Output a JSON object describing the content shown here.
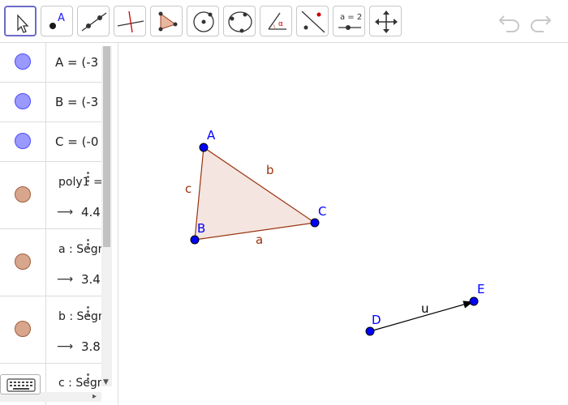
{
  "toolbar": {
    "tools": [
      {
        "icon": "move-arrow-icon",
        "selected": true
      },
      {
        "icon": "point-icon",
        "label": "A"
      },
      {
        "icon": "line-icon"
      },
      {
        "icon": "perpendicular-line-icon"
      },
      {
        "icon": "polygon-icon"
      },
      {
        "icon": "circle-center-point-icon"
      },
      {
        "icon": "circle-three-points-icon"
      },
      {
        "icon": "angle-icon",
        "label": "α"
      },
      {
        "icon": "reflect-about-line-icon"
      },
      {
        "icon": "slider-icon",
        "label": "a = 2"
      },
      {
        "icon": "move-graphics-view-icon"
      }
    ],
    "undo_icon": "undo-icon",
    "redo_icon": "redo-icon"
  },
  "algebra": {
    "rows": [
      {
        "type": "point",
        "definition": "A = (-3"
      },
      {
        "type": "point",
        "definition": "B = (-3"
      },
      {
        "type": "point",
        "definition": "C = (-0"
      },
      {
        "type": "shape",
        "definition": "poly1 =",
        "value": "4.4"
      },
      {
        "type": "shape",
        "definition": "a : Segm",
        "value": "3.4"
      },
      {
        "type": "shape",
        "definition": "b : Segm",
        "value": "3.8"
      },
      {
        "type": "shape",
        "definition": "c : Segm"
      }
    ],
    "result_arrow": "⟶"
  },
  "graphics": {
    "points": {
      "A": "A",
      "B": "B",
      "C": "C",
      "D": "D",
      "E": "E"
    },
    "segments": {
      "a": "a",
      "b": "b",
      "c": "c"
    },
    "vector": "u",
    "colors": {
      "point_fill": "#0000ff",
      "point_stroke": "#000000",
      "segment": "#99330f",
      "polygon_fill": "#f5e5e0",
      "vector": "#000000"
    }
  }
}
